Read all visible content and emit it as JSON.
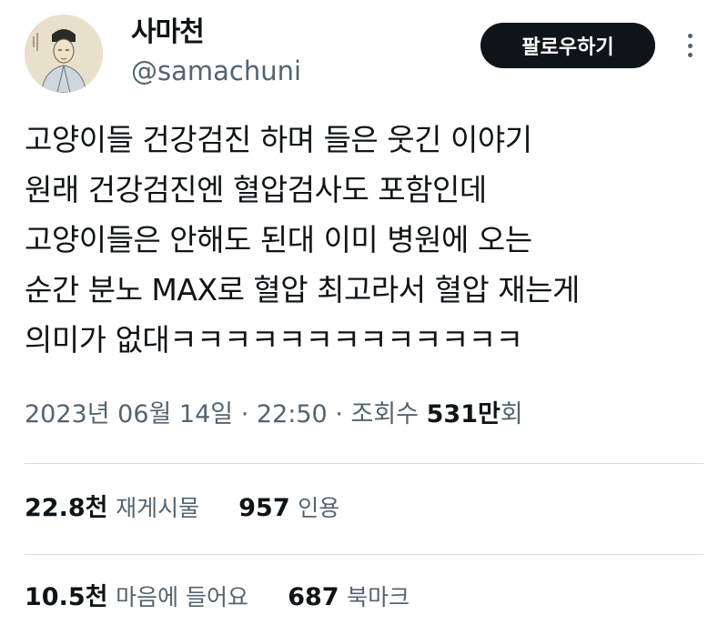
{
  "author": {
    "display_name": "사마천",
    "handle": "@samachuni",
    "avatar_icon": "ink-portrait-avatar"
  },
  "actions": {
    "follow_label": "팔로우하기",
    "more_icon": "more-vertical-icon"
  },
  "tweet": {
    "lines": [
      "고양이들 건강검진 하며 들은 웃긴 이야기",
      "원래 건강검진엔 혈압검사도 포함인데",
      "고양이들은 안해도 된대 이미 병원에 오는",
      "순간 분노 MAX로 혈압 최고라서 혈압 재는게",
      "의미가 없대ㅋㅋㅋㅋㅋㅋㅋㅋㅋㅋㅋㅋㅋ"
    ]
  },
  "meta": {
    "date": "2023년 06월 14일",
    "separator": "·",
    "time": "22:50",
    "views_label": "조회수",
    "views_count": "531만",
    "views_unit": "회"
  },
  "stats": {
    "retweets_count": "22.8천",
    "retweets_label": "재게시물",
    "quotes_count": "957",
    "quotes_label": "인용",
    "likes_count": "10.5천",
    "likes_label": "마음에 들어요",
    "bookmarks_count": "687",
    "bookmarks_label": "북마크"
  },
  "colors": {
    "text": "#0f1419",
    "secondary_text": "#536471",
    "button_bg": "#0f1419",
    "button_text": "#ffffff",
    "divider": "#d6dde2"
  }
}
